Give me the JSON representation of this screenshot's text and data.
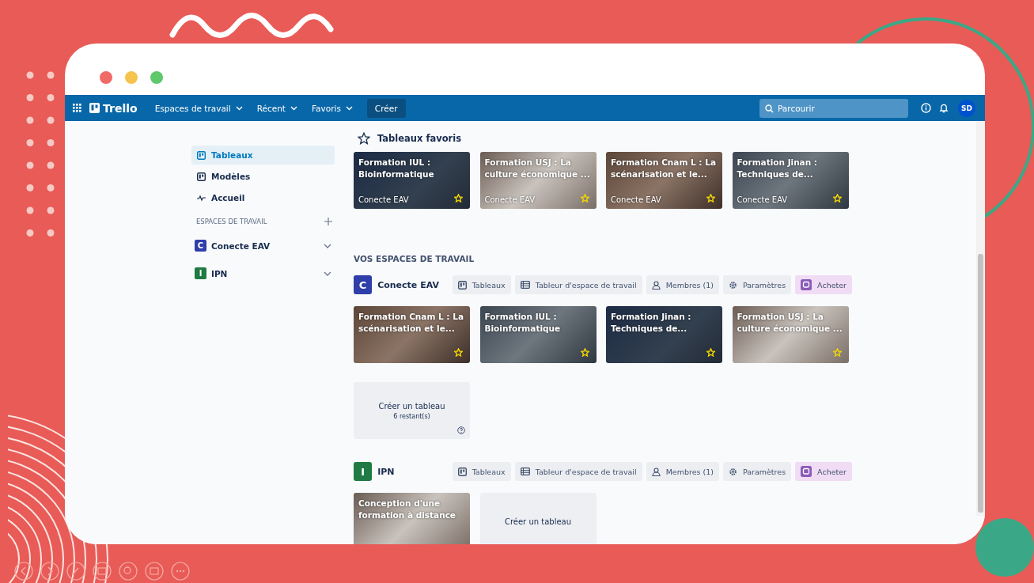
{
  "navbar": {
    "logo": "Trello",
    "menus": [
      "Espaces de travail",
      "Récent",
      "Favoris"
    ],
    "create": "Créer",
    "search": {
      "placeholder": "Parcourir"
    },
    "avatar": "SD"
  },
  "sidebar": {
    "items": [
      {
        "label": "Tableaux",
        "kind": "boards",
        "selected": true
      },
      {
        "label": "Modèles",
        "kind": "templates",
        "selected": false
      },
      {
        "label": "Accueil",
        "kind": "home",
        "selected": false
      }
    ],
    "section_title": "ESPACES DE TRAVAIL",
    "workspaces": [
      {
        "letter": "C",
        "name": "Conecte EAV",
        "color": "#2f3ea8"
      },
      {
        "letter": "I",
        "name": "IPN",
        "color": "#1f7a44"
      }
    ]
  },
  "favorites": {
    "title": "Tableaux favoris",
    "boards": [
      {
        "title": "Formation IUL : Bioinformatique",
        "workspace": "Conecte EAV",
        "starred": true
      },
      {
        "title": "Formation USJ : La culture économique ...",
        "workspace": "Conecte EAV",
        "starred": true
      },
      {
        "title": "Formation Cnam L : La scénarisation et le...",
        "workspace": "Conecte EAV",
        "starred": true
      },
      {
        "title": "Formation Jinan : Techniques de...",
        "workspace": "Conecte EAV",
        "starred": true
      }
    ]
  },
  "workspaces_title": "VOS ESPACES DE TRAVAIL",
  "workspaces": [
    {
      "letter": "C",
      "name": "Conecte EAV",
      "color": "#2f3ea8",
      "tabs": [
        {
          "label": "Tableaux",
          "kind": "boards"
        },
        {
          "label": "Tableur d'espace de travail",
          "kind": "table"
        },
        {
          "label": "Membres (1)",
          "kind": "members"
        },
        {
          "label": "Paramètres",
          "kind": "settings"
        },
        {
          "label": "Acheter",
          "kind": "upgrade"
        }
      ],
      "boards": [
        {
          "title": "Formation Cnam L : La scénarisation et le...",
          "starred": true
        },
        {
          "title": "Formation IUL : Bioinformatique",
          "starred": true
        },
        {
          "title": "Formation Jinan : Techniques de...",
          "starred": true
        },
        {
          "title": "Formation USJ : La culture économique ...",
          "starred": true
        }
      ],
      "create": {
        "label": "Créer un tableau",
        "remaining": "6 restant(s)"
      }
    },
    {
      "letter": "I",
      "name": "IPN",
      "color": "#1f7a44",
      "tabs": [
        {
          "label": "Tableaux",
          "kind": "boards"
        },
        {
          "label": "Tableur d'espace de travail",
          "kind": "table"
        },
        {
          "label": "Membres (1)",
          "kind": "members"
        },
        {
          "label": "Paramètres",
          "kind": "settings"
        },
        {
          "label": "Acheter",
          "kind": "upgrade"
        }
      ],
      "boards": [
        {
          "title": "Conception d'une formation à distance",
          "starred": false
        }
      ],
      "create": {
        "label": "Créer un tableau"
      }
    }
  ]
}
